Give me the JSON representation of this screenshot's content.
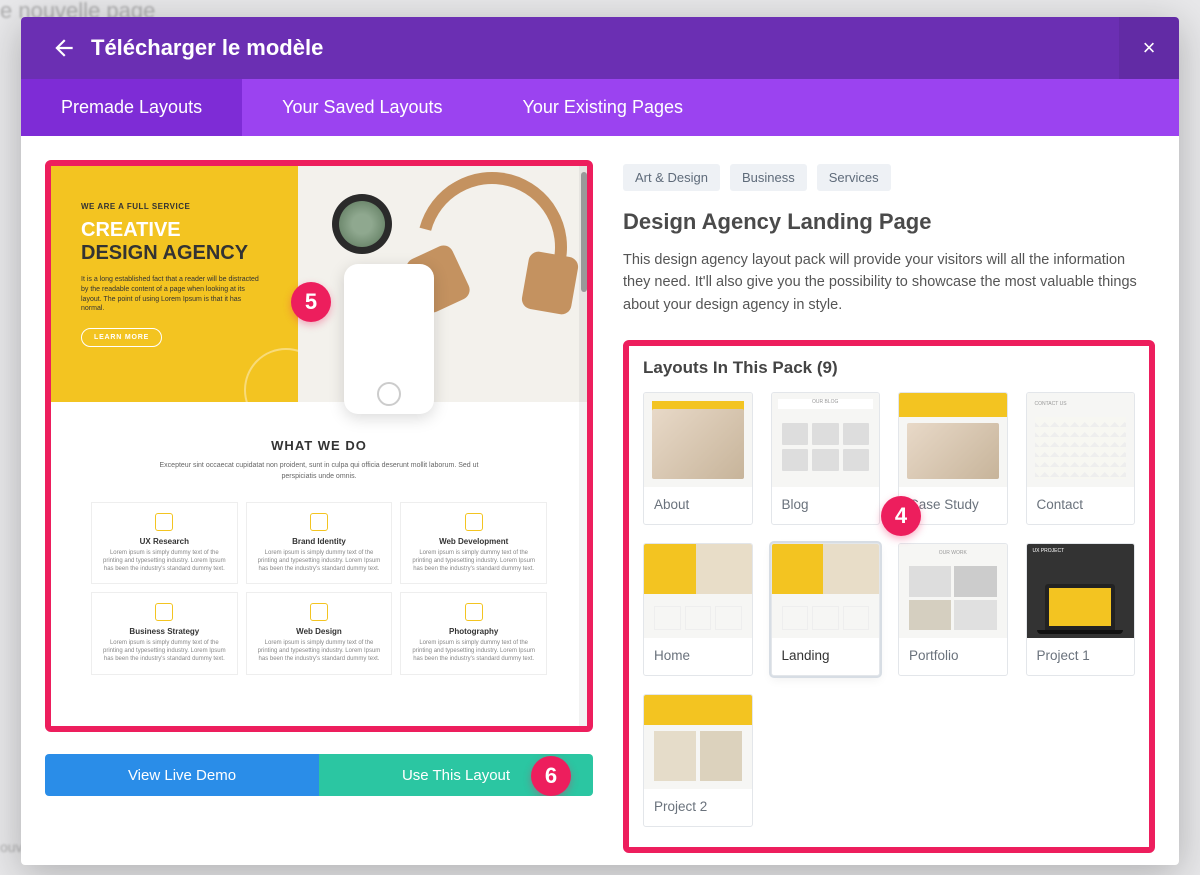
{
  "bg": {
    "top": "e nouvelle page",
    "bottom": "ouveau champ personnalisé"
  },
  "modal": {
    "title": "Télécharger le modèle",
    "close": "×"
  },
  "tabs": [
    {
      "label": "Premade Layouts",
      "active": true
    },
    {
      "label": "Your Saved Layouts",
      "active": false
    },
    {
      "label": "Your Existing Pages",
      "active": false
    }
  ],
  "preview": {
    "tag": "WE ARE A FULL SERVICE",
    "title_top": "CREATIVE",
    "title_bot": "DESIGN AGENCY",
    "lorem": "It is a long established fact that a reader will be distracted by the readable content of a page when looking at its layout. The point of using Lorem Ipsum is that it has normal.",
    "cta": "LEARN MORE",
    "what": "WHAT WE DO",
    "what_sub": "Excepteur sint occaecat cupidatat non proident, sunt in culpa qui officia deserunt mollit laborum. Sed ut perspiciatis unde omnis.",
    "cards": [
      "UX Research",
      "Brand Identity",
      "Web Development",
      "Business Strategy",
      "Web Design",
      "Photography"
    ],
    "card_txt": "Lorem ipsum is simply dummy text of the printing and typesetting industry. Lorem Ipsum has been the industry's standard dummy text."
  },
  "buttons": {
    "demo": "View Live Demo",
    "use": "Use This Layout"
  },
  "categories": [
    "Art & Design",
    "Business",
    "Services"
  ],
  "detail": {
    "title": "Design Agency Landing Page",
    "desc": "This design agency layout pack will provide your visitors will all the information they need. It'll also give you the possibility to showcase the most valuable things about your design agency in style."
  },
  "pack": {
    "heading": "Layouts In This Pack (9)",
    "items": [
      {
        "label": "About"
      },
      {
        "label": "Blog"
      },
      {
        "label": "Case Study"
      },
      {
        "label": "Contact"
      },
      {
        "label": "Home"
      },
      {
        "label": "Landing",
        "selected": true
      },
      {
        "label": "Portfolio"
      },
      {
        "label": "Project 1"
      },
      {
        "label": "Project 2"
      }
    ]
  },
  "annotations": {
    "b4": "4",
    "b5": "5",
    "b6": "6"
  },
  "colors": {
    "accent": "#ed1e5d",
    "yellow": "#f3c421"
  }
}
